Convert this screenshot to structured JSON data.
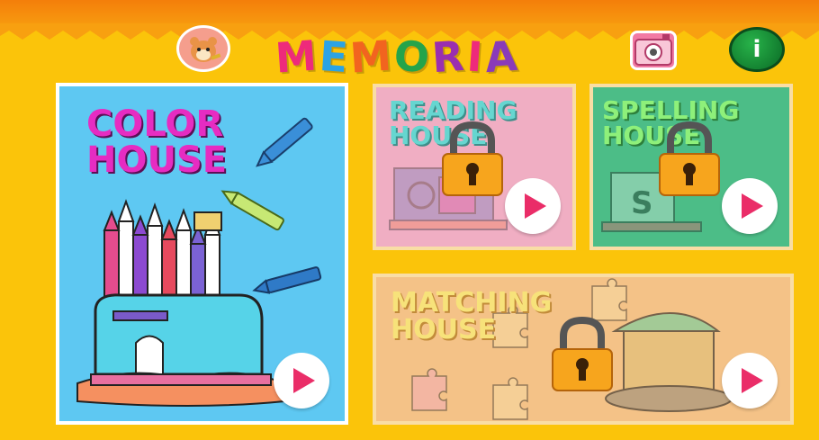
{
  "app": {
    "title_letters": [
      {
        "char": "M",
        "color": "#ee2a7b"
      },
      {
        "char": "E",
        "color": "#2ba3e5"
      },
      {
        "char": "M",
        "color": "#f2641f"
      },
      {
        "char": "O",
        "color": "#24a44a"
      },
      {
        "char": "R",
        "color": "#9a2fb0"
      },
      {
        "char": "I",
        "color": "#ee2a7b"
      },
      {
        "char": "A",
        "color": "#8a3ab9"
      }
    ]
  },
  "header": {
    "profile_icon": "hamster-icon",
    "camera_icon": "camera-icon",
    "info_label": "i"
  },
  "cards": {
    "color": {
      "line1": "COLOR",
      "line2": "HOUSE",
      "locked": false
    },
    "reading": {
      "line1": "READING",
      "line2": "HOUSE",
      "locked": true
    },
    "spelling": {
      "line1": "SPELLING",
      "line2": "HOUSE",
      "locked": true
    },
    "matching": {
      "line1": "MATCHING",
      "line2": "HOUSE",
      "locked": true
    }
  },
  "colors": {
    "background": "#fbc40a",
    "topbar": "#f47e0a",
    "play": "#ea2d68"
  }
}
